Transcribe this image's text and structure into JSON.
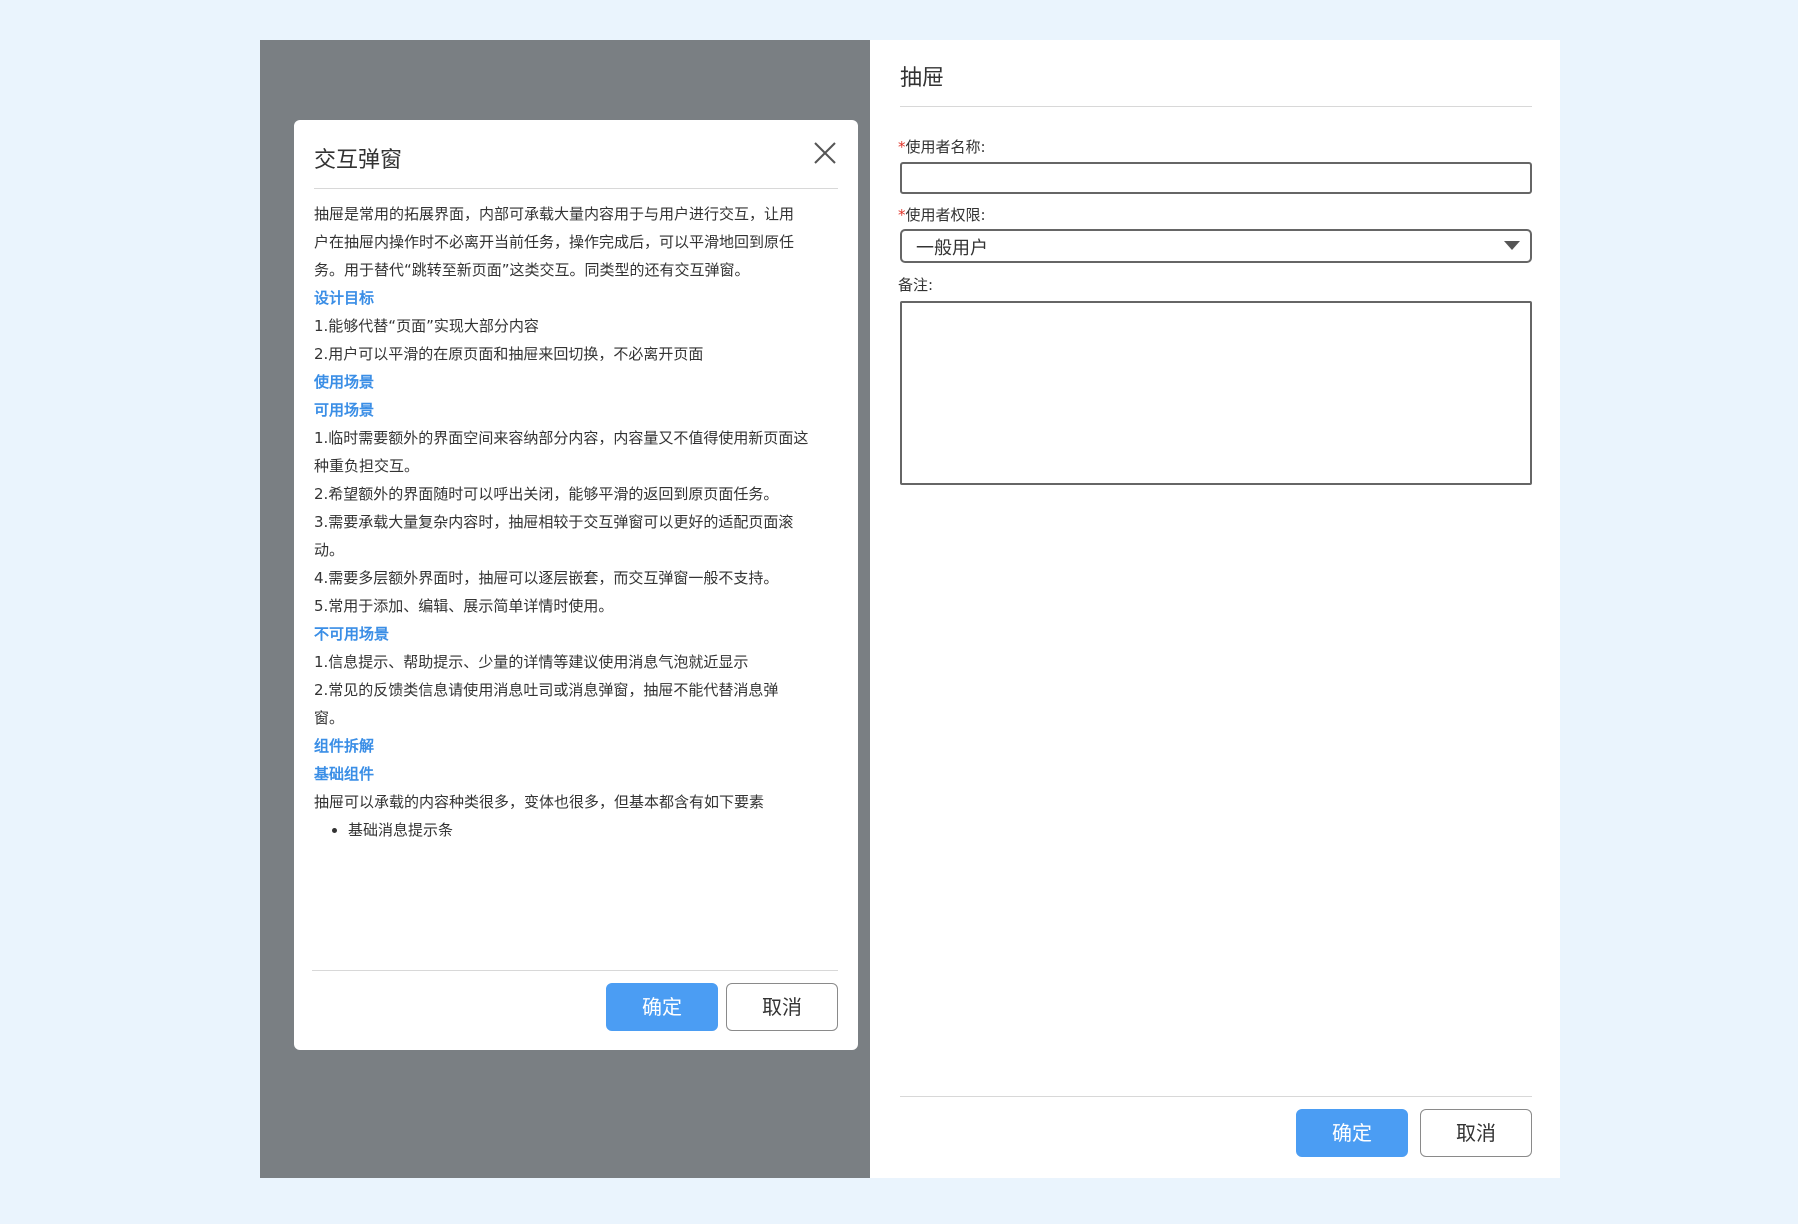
{
  "modal": {
    "title": "交互弹窗",
    "body": {
      "intro": [
        "抽屉是常用的拓展界面，内部可承载大量内容用于与用户进行交互，让用",
        "户在抽屉内操作时不必离开当前任务，操作完成后，可以平滑地回到原任",
        "务。用于替代“跳转至新页面”这类交互。同类型的还有交互弹窗。"
      ],
      "design_goal_heading": "设计目标",
      "design_goals": [
        "1.能够代替“页面”实现大部分内容",
        "2.用户可以平滑的在原页面和抽屉来回切换，不必离开页面"
      ],
      "usage_heading": "使用场景",
      "usable_heading": "可用场景",
      "usable_lines": [
        "1.临时需要额外的界面空间来容纳部分内容，内容量又不值得使用新页面这",
        "种重负担交互。",
        "2.希望额外的界面随时可以呼出关闭，能够平滑的返回到原页面任务。",
        "3.需要承载大量复杂内容时，抽屉相较于交互弹窗可以更好的适配页面滚",
        "动。",
        "4.需要多层额外界面时，抽屉可以逐层嵌套，而交互弹窗一般不支持。",
        "5.常用于添加、编辑、展示简单详情时使用。"
      ],
      "unusable_heading": "不可用场景",
      "unusable_lines": [
        "1.信息提示、帮助提示、少量的详情等建议使用消息气泡就近显示",
        "2.常见的反馈类信息请使用消息吐司或消息弹窗，抽屉不能代替消息弹",
        "窗。"
      ],
      "breakdown_heading": "组件拆解",
      "basic_heading": "基础组件",
      "basic_text": "抽屉可以承载的内容种类很多，变体也很多，但基本都含有如下要素",
      "basic_list": [
        "基础消息提示条"
      ]
    },
    "confirm_label": "确定",
    "cancel_label": "取消"
  },
  "drawer": {
    "title": "抽屉",
    "fields": {
      "username": {
        "required_mark": "*",
        "label": "使用者名称:",
        "value": ""
      },
      "permission": {
        "required_mark": "*",
        "label": "使用者权限:",
        "selected": "一般用户"
      },
      "remark": {
        "label": "备注:",
        "value": ""
      }
    },
    "confirm_label": "确定",
    "cancel_label": "取消"
  },
  "colors": {
    "page_bg": "#eaf4fd",
    "overlay": "#7a7f83",
    "primary": "#4b9df3",
    "heading_link": "#3a8ee6",
    "required": "#e0352b"
  },
  "icons": {
    "close": "close-icon",
    "dropdown": "chevron-down-icon"
  }
}
